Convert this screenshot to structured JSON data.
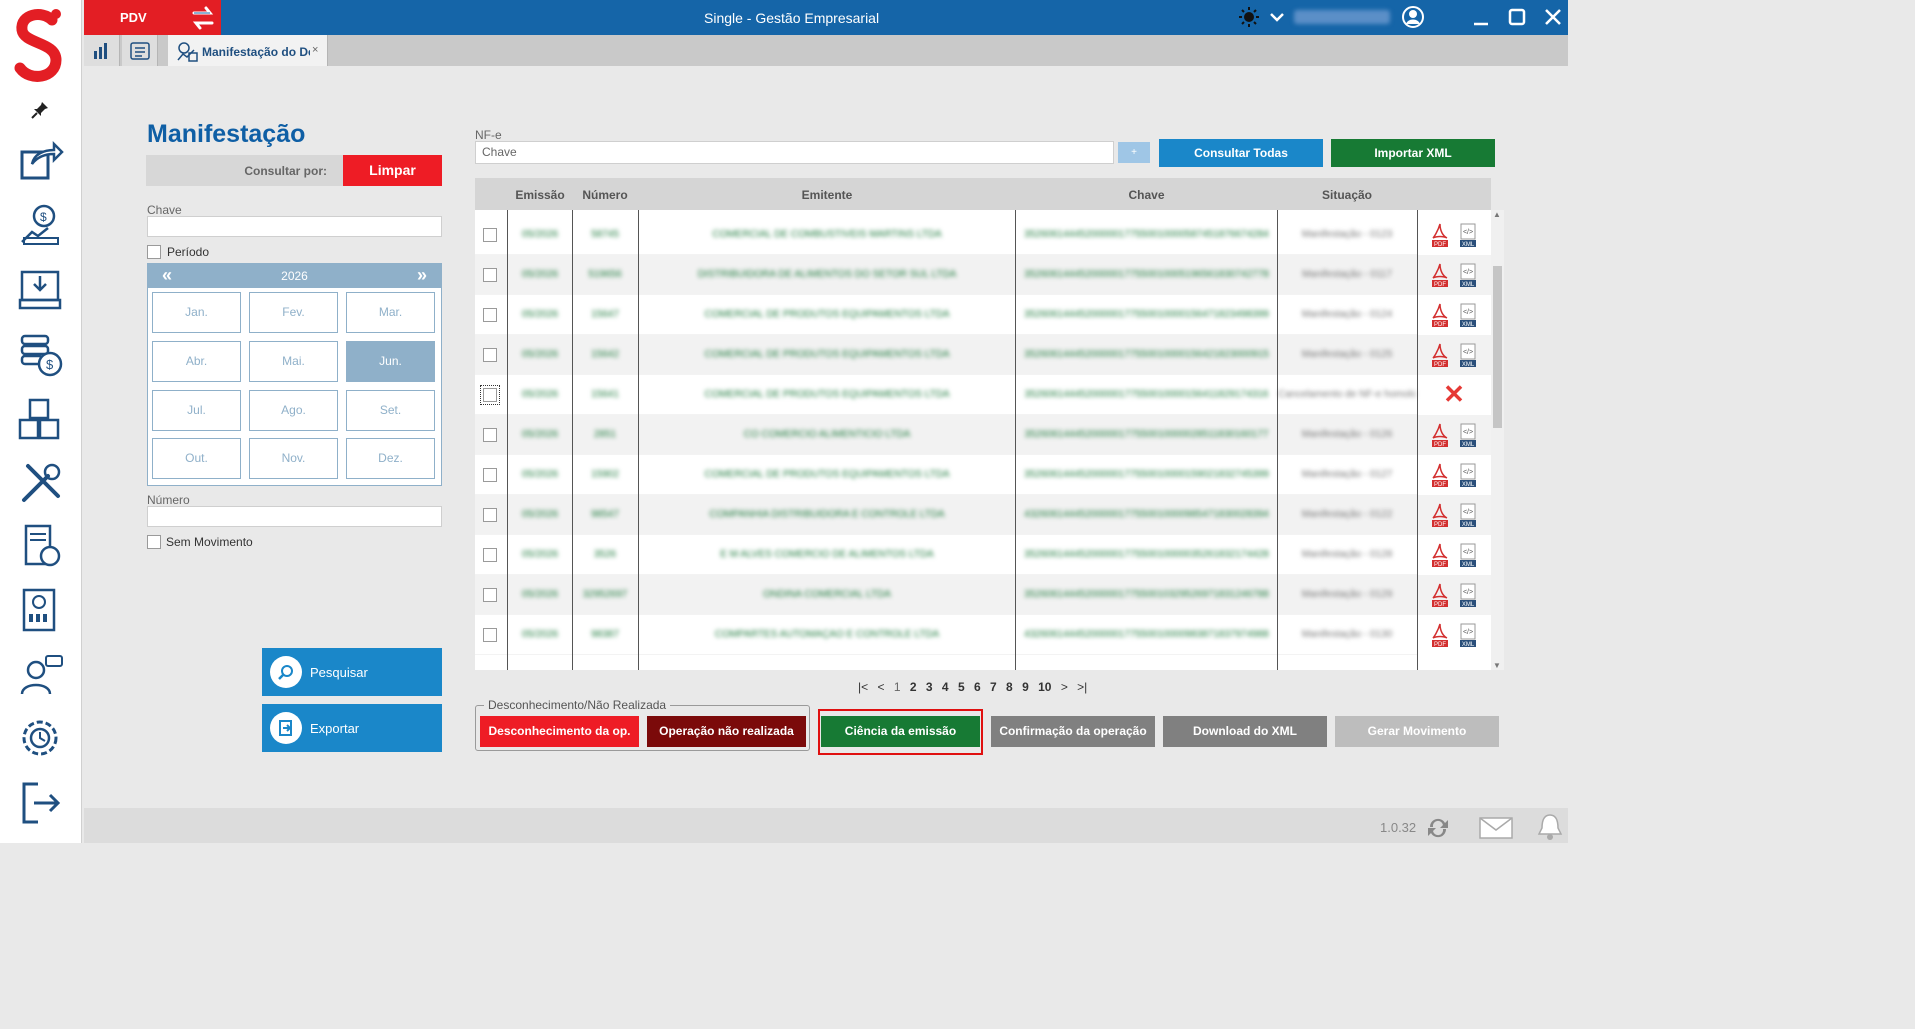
{
  "window": {
    "title": "Single - Gestão Empresarial",
    "pdv_label": "PDV"
  },
  "tabs": {
    "active_label": "Manifestação do De",
    "close_glyph": "×"
  },
  "left_panel": {
    "heading": "Manifestação",
    "consult_label": "Consultar por:",
    "clear_button": "Limpar",
    "chave_label": "Chave",
    "periodo_label": "Período",
    "calendar": {
      "year": "2026",
      "prev": "«",
      "next": "»",
      "months": [
        "Jan.",
        "Fev.",
        "Mar.",
        "Abr.",
        "Mai.",
        "Jun.",
        "Jul.",
        "Ago.",
        "Set.",
        "Out.",
        "Nov.",
        "Dez."
      ],
      "selected_month": "Jun."
    },
    "numero_label": "Número",
    "sem_movimento_label": "Sem Movimento",
    "search_button": "Pesquisar",
    "export_button": "Exportar"
  },
  "nfe": {
    "label": "NF-e",
    "placeholder": "Chave",
    "plus_button": "+",
    "consult_all_button": "Consultar Todas",
    "import_button": "Importar XML"
  },
  "grid": {
    "columns": [
      "Emissão",
      "Número",
      "Emitente",
      "Chave",
      "Situação"
    ],
    "rows": [
      {
        "emissao": "05/2026",
        "numero": "58745",
        "emitente": "COMERCIAL DE COMBUSTIVEIS MARTINS LTDA",
        "chave": "35260614445200000177550010000587451876674284",
        "situacao": "Manifestação - 0123",
        "status": "ok"
      },
      {
        "emissao": "05/2026",
        "numero": "519656",
        "emitente": "DISTRIBUIDORA DE ALIMENTOS DO SETOR SUL LTDA",
        "chave": "35260614445200000177550010005196561830742778",
        "situacao": "Manifestação - 0117",
        "status": "ok"
      },
      {
        "emissao": "05/2026",
        "numero": "15647",
        "emitente": "COMERCIAL DE PRODUTOS EQUIPAMENTOS LTDA",
        "chave": "35260614445200000177550010000156471823498399",
        "situacao": "Manifestação - 0124",
        "status": "ok"
      },
      {
        "emissao": "05/2026",
        "numero": "15642",
        "emitente": "COMERCIAL DE PRODUTOS EQUIPAMENTOS LTDA",
        "chave": "35260614445200000177550010000156421823000915",
        "situacao": "Manifestação - 0125",
        "status": "ok"
      },
      {
        "emissao": "05/2026",
        "numero": "15641",
        "emitente": "COMERCIAL DE PRODUTOS EQUIPAMENTOS LTDA",
        "chave": "35260614445200000177550010000156411829174316",
        "situacao": "Cancelamento de NF-e homologado",
        "status": "cancelled"
      },
      {
        "emissao": "05/2026",
        "numero": "2851",
        "emitente": "CO COMERCIO ALIMENTICIO LTDA",
        "chave": "35260614445200000177550010000028511830160177",
        "situacao": "Manifestação - 0126",
        "status": "ok"
      },
      {
        "emissao": "05/2026",
        "numero": "15902",
        "emitente": "COMERCIAL DE PRODUTOS EQUIPAMENTOS LTDA",
        "chave": "35260614445200000177550010000159021832745399",
        "situacao": "Manifestação - 0127",
        "status": "ok"
      },
      {
        "emissao": "05/2026",
        "numero": "98547",
        "emitente": "COMPANHIA DISTRIBUIDORA E CONTROLE LTDA",
        "chave": "43260614445200000177550010000985471830028394",
        "situacao": "Manifestação - 0122",
        "status": "ok"
      },
      {
        "emissao": "05/2026",
        "numero": "3526",
        "emitente": "E M ALVES COMERCIO DE ALIMENTOS LTDA",
        "chave": "35260614445200000177550010000035261832174428",
        "situacao": "Manifestação - 0128",
        "status": "ok"
      },
      {
        "emissao": "05/2026",
        "numero": "32952697",
        "emitente": "ONDINA COMERCIAL LTDA",
        "chave": "35260614445200000177550010329526971831246788",
        "situacao": "Manifestação - 0129",
        "status": "ok"
      },
      {
        "emissao": "05/2026",
        "numero": "98387",
        "emitente": "COMPARTES AUTOMAÇÃO E CONTROLE LTDA",
        "chave": "43260614445200000177550010000983871837974988",
        "situacao": "Manifestação - 0130",
        "status": "ok"
      }
    ],
    "pdf_label": "PDF",
    "xml_label": "XML"
  },
  "pager": {
    "first": "|<",
    "prev": "<",
    "pages": [
      "1",
      "2",
      "3",
      "4",
      "5",
      "6",
      "7",
      "8",
      "9",
      "10"
    ],
    "current": "1",
    "next": ">",
    "last": ">|"
  },
  "actions": {
    "group_label": "Desconhecimento/Não Realizada",
    "desconhecimento": "Desconhecimento da op.",
    "nao_realizada": "Operação não realizada",
    "ciencia": "Ciência da emissão",
    "confirmacao": "Confirmação da operação",
    "download": "Download do XML",
    "gerar": "Gerar Movimento"
  },
  "footer": {
    "version": "1.0.32"
  },
  "colors": {
    "brand_blue": "#1565a8",
    "brand_red": "#e31e24",
    "action_blue": "#1a87c9",
    "green": "#177a34",
    "dark_red": "#7b0a0a"
  },
  "icons": [
    "pin-icon",
    "share-icon",
    "money-upload-icon",
    "inbox-icon",
    "coins-icon",
    "boxes-icon",
    "tools-icon",
    "invoice-icon",
    "report-icon",
    "support-icon",
    "settings-clock-icon",
    "logout-icon",
    "theme-icon",
    "user-icon",
    "sync-icon",
    "mail-icon",
    "bell-icon"
  ]
}
